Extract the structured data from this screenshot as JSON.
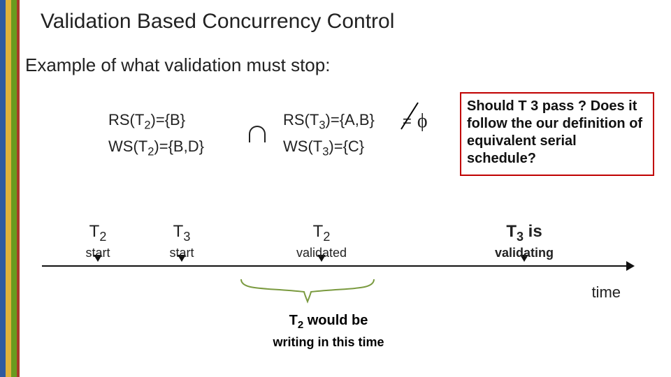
{
  "title": "Validation Based Concurrency Control",
  "subtitle": "Example of what validation must stop:",
  "sets": {
    "t2": {
      "rs_label": "RS(T",
      "rs_sub": "2",
      "rs_val": ")={B}",
      "ws_label": "WS(T",
      "ws_sub": "2",
      "ws_val": ")={B,D}"
    },
    "t3": {
      "rs_label": "RS(T",
      "rs_sub": "3",
      "rs_val": ")={A,B}",
      "ws_label": "WS(T",
      "ws_sub": "3",
      "ws_val": ")={C}"
    }
  },
  "neq_symbol": "=",
  "phi_symbol": "ϕ",
  "question": "Should T 3 pass ? Does it follow the our definition of equivalent serial schedule?",
  "events": {
    "t2_start": {
      "main_a": "T",
      "main_sub": "2",
      "sub": "start"
    },
    "t3_start": {
      "main_a": "T",
      "main_sub": "3",
      "sub": "start"
    },
    "t2_val": {
      "main_a": "T",
      "main_sub": "2",
      "sub": "validated"
    },
    "t3_val": {
      "main_a": "T",
      "main_sub": "3",
      "main_tail": " is",
      "sub": "validating"
    }
  },
  "t2_write": {
    "line1_a": "T",
    "line1_sub": "2",
    "line1_tail": " would be",
    "line2": "writing in this time"
  },
  "time_label": "time"
}
